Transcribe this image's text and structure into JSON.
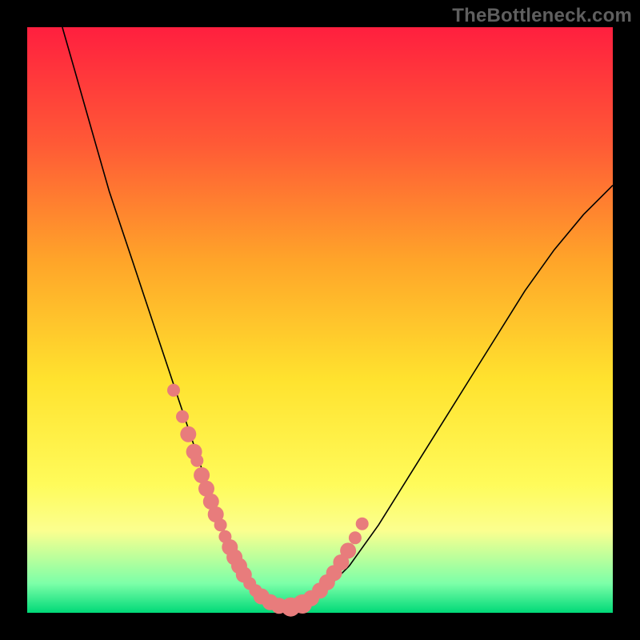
{
  "watermark": "TheBottleneck.com",
  "colors": {
    "background": "#000000",
    "curve": "#000000",
    "dots": "#e87c7c",
    "gradient_stops": [
      "#ff1f3f",
      "#ff5a36",
      "#ffa529",
      "#ffe22e",
      "#fffb5a",
      "#fbff8f",
      "#7cffa8",
      "#00d978"
    ]
  },
  "chart_data": {
    "type": "line",
    "title": "",
    "xlabel": "",
    "ylabel": "",
    "xlim": [
      0,
      100
    ],
    "ylim": [
      0,
      100
    ],
    "grid": false,
    "legend": false,
    "series": [
      {
        "name": "bottleneck-curve",
        "x": [
          6,
          8,
          10,
          12,
          14,
          16,
          18,
          20,
          22,
          24,
          26,
          28,
          30,
          32,
          34,
          36,
          38,
          40,
          42,
          45,
          50,
          55,
          60,
          65,
          70,
          75,
          80,
          85,
          90,
          95,
          100
        ],
        "y": [
          100,
          93,
          86,
          79,
          72,
          66,
          60,
          54,
          48,
          42,
          36,
          30,
          24,
          18,
          13,
          9,
          5.5,
          3,
          1.5,
          0.8,
          3,
          8,
          15,
          23,
          31,
          39,
          47,
          55,
          62,
          68,
          73
        ]
      }
    ],
    "highlight_points": {
      "name": "salmon-dots",
      "x": [
        25,
        26.5,
        27.5,
        28.5,
        29,
        29.8,
        30.6,
        31.4,
        32.2,
        33,
        33.8,
        34.6,
        35.4,
        36.2,
        37,
        38,
        39,
        40,
        41.5,
        43,
        45,
        47,
        48.5,
        50,
        51.2,
        52.4,
        53.6,
        54.8,
        56,
        57.2
      ],
      "y": [
        38,
        33.5,
        30.5,
        27.5,
        26,
        23.5,
        21.2,
        19,
        16.8,
        15,
        13,
        11.2,
        9.5,
        8,
        6.5,
        5,
        3.8,
        2.8,
        1.8,
        1.2,
        1,
        1.5,
        2.5,
        3.8,
        5.2,
        6.8,
        8.6,
        10.6,
        12.8,
        15.2
      ],
      "radius_px": [
        8,
        8,
        10,
        10,
        8,
        10,
        10,
        10,
        10,
        8,
        8,
        10,
        10,
        10,
        10,
        8,
        8,
        10,
        10,
        10,
        12,
        12,
        10,
        10,
        10,
        10,
        10,
        10,
        8,
        8
      ]
    }
  }
}
